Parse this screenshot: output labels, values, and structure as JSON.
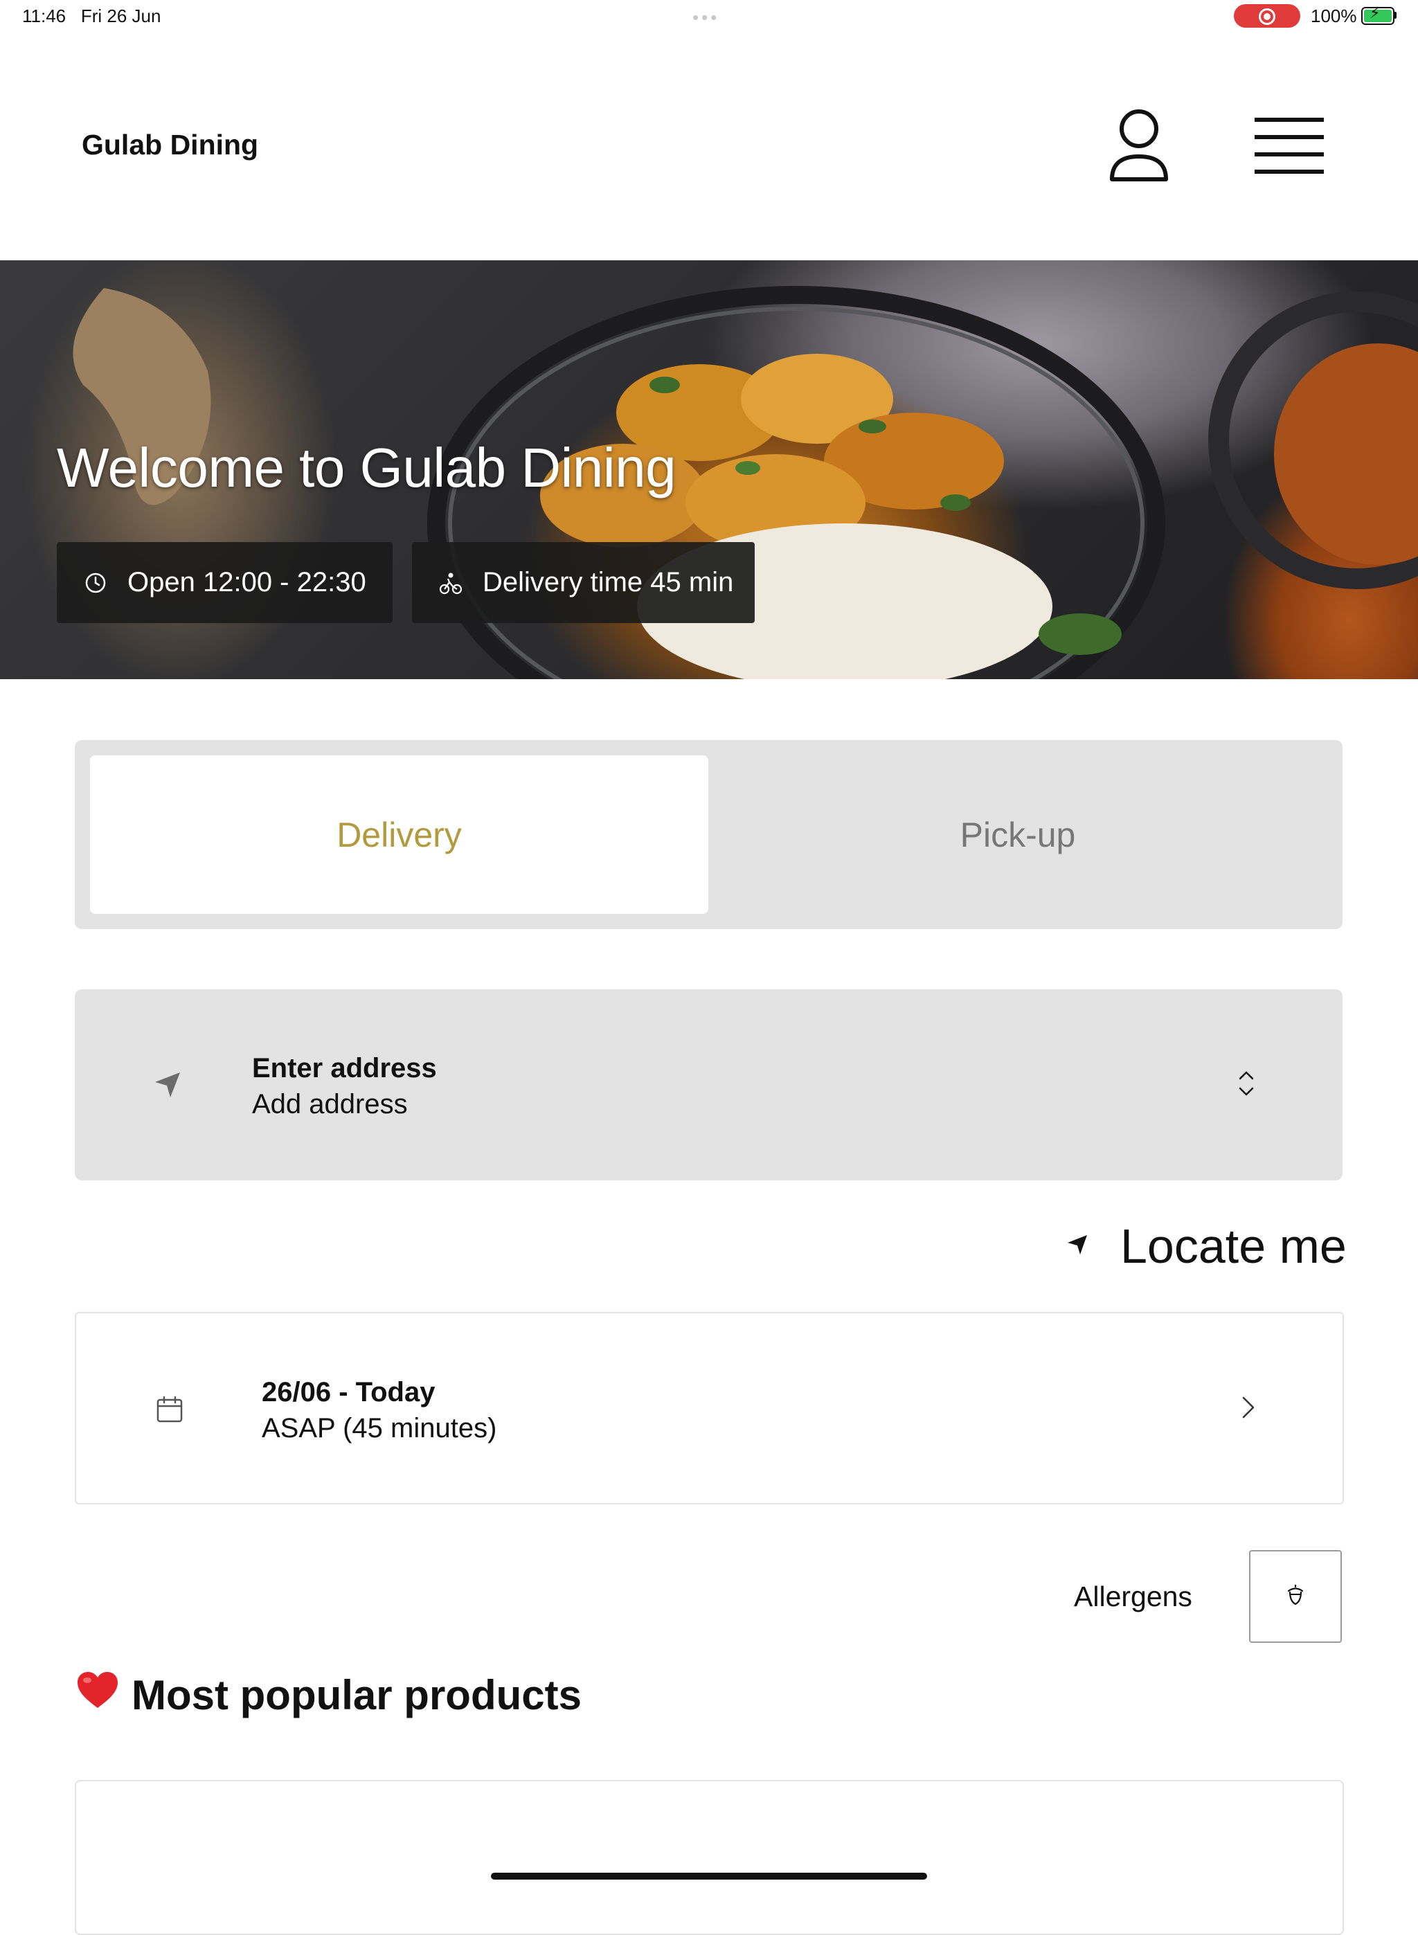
{
  "status_bar": {
    "time": "11:46",
    "date": "Fri 26 Jun",
    "battery_percent": "100%",
    "recording": true,
    "colors": {
      "recording": "#e03a3a",
      "battery": "#34c759"
    }
  },
  "header": {
    "brand": "Gulab Dining",
    "icons": [
      "user-icon",
      "menu-icon"
    ]
  },
  "hero": {
    "title": "Welcome to Gulab Dining",
    "hours": "Open 12:00 - 22:30",
    "delivery_time": "Delivery time 45 min",
    "icons": [
      "clock-icon",
      "bike-icon"
    ]
  },
  "order_mode": {
    "options": [
      "Delivery",
      "Pick-up"
    ],
    "selected": "Delivery",
    "colors": {
      "active_text": "#b39a3e",
      "inactive_text": "#777777"
    }
  },
  "address": {
    "title": "Enter address",
    "subtitle": "Add address"
  },
  "locate": {
    "label": "Locate me"
  },
  "schedule": {
    "date": "26/06 - Today",
    "time": "ASAP (45 minutes)"
  },
  "allergens": {
    "label": "Allergens"
  },
  "section": {
    "title": "Most popular products",
    "emoji_icon": "heart-icon"
  }
}
